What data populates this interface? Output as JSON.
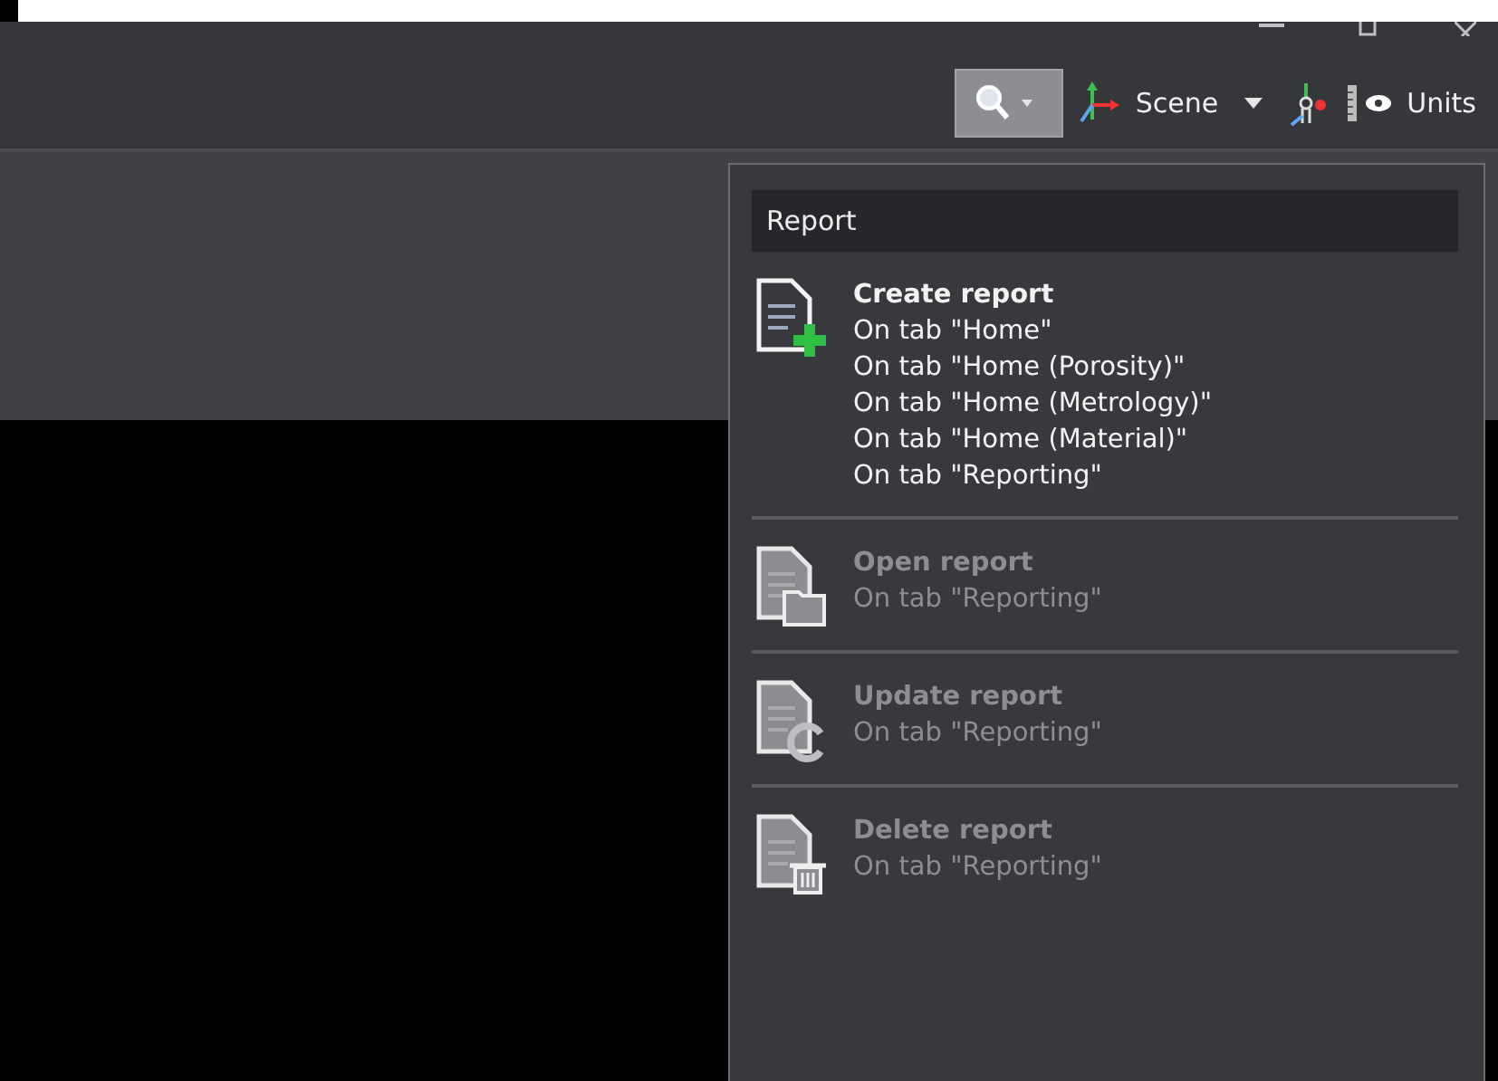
{
  "toolbar": {
    "search": {
      "selected": true
    },
    "scene": {
      "label": "Scene"
    },
    "units": {
      "label": "Units"
    }
  },
  "report_menu": {
    "title": "Report",
    "items": [
      {
        "kind": "create",
        "label": "Create report",
        "disabled": false,
        "lines": [
          "On tab \"Home\"",
          "On tab \"Home (Porosity)\"",
          "On tab \"Home (Metrology)\"",
          "On tab \"Home (Material)\"",
          "On tab \"Reporting\""
        ]
      },
      {
        "kind": "open",
        "label": "Open report",
        "disabled": true,
        "lines": [
          "On tab \"Reporting\""
        ]
      },
      {
        "kind": "update",
        "label": "Update report",
        "disabled": true,
        "lines": [
          "On tab \"Reporting\""
        ]
      },
      {
        "kind": "delete",
        "label": "Delete report",
        "disabled": true,
        "lines": [
          "On tab \"Reporting\""
        ]
      }
    ]
  }
}
